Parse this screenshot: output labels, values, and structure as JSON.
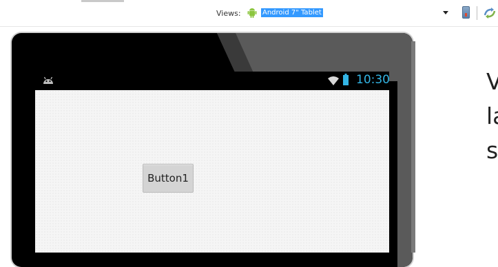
{
  "toolbar": {
    "views_label": "Views:",
    "views_selected": "Android 7\" Tablet",
    "icons": [
      "android-icon",
      "chevron-down-icon",
      "device-icon",
      "refresh-icon"
    ]
  },
  "device": {
    "status_time": "10:30",
    "status_icons": [
      "android-icon",
      "wifi-icon",
      "battery-icon"
    ],
    "button_label": "Button1"
  },
  "slide_text": {
    "line1": "V",
    "line2": "la",
    "line3": "s"
  },
  "colors": {
    "selection": "#3399ff",
    "clock": "#33b5e5",
    "tablet_frame": "#000000",
    "screen_bg": "#f5f5f5"
  }
}
